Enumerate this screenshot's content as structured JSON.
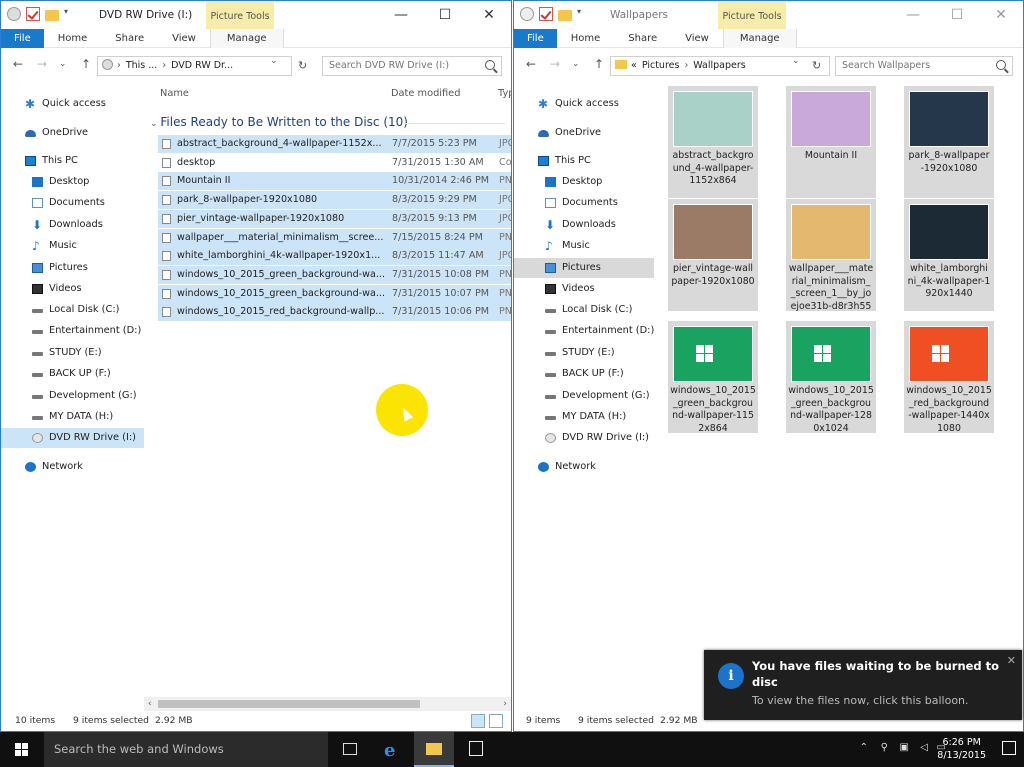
{
  "left_window": {
    "title": "DVD RW Drive (I:)",
    "context_tab": "Picture Tools",
    "ribbon_tabs": [
      "File",
      "Home",
      "Share",
      "View",
      "Manage"
    ],
    "address_crumbs": [
      "This ...",
      "DVD RW Dr..."
    ],
    "search_placeholder": "Search DVD RW Drive (I:)",
    "columns": {
      "name": "Name",
      "date": "Date modified",
      "type": "Typ"
    },
    "group_header": "Files Ready to Be Written to the Disc (10)",
    "files": [
      {
        "name": "abstract_background_4-wallpaper-1152x...",
        "date": "7/7/2015 5:23 PM",
        "type": "JPG",
        "selected": true
      },
      {
        "name": "desktop",
        "date": "7/31/2015 1:30 AM",
        "type": "Con",
        "selected": false
      },
      {
        "name": "Mountain II",
        "date": "10/31/2014 2:46 PM",
        "type": "PN",
        "selected": true
      },
      {
        "name": "park_8-wallpaper-1920x1080",
        "date": "8/3/2015 9:29 PM",
        "type": "JPG",
        "selected": true
      },
      {
        "name": "pier_vintage-wallpaper-1920x1080",
        "date": "8/3/2015 9:13 PM",
        "type": "JPG",
        "selected": true
      },
      {
        "name": "wallpaper___material_minimalism__scree...",
        "date": "7/15/2015 8:24 PM",
        "type": "PN",
        "selected": true
      },
      {
        "name": "white_lamborghini_4k-wallpaper-1920x1...",
        "date": "8/3/2015 11:47 AM",
        "type": "JPG",
        "selected": true
      },
      {
        "name": "windows_10_2015_green_background-wa...",
        "date": "7/31/2015 10:08 PM",
        "type": "PN",
        "selected": true
      },
      {
        "name": "windows_10_2015_green_background-wa...",
        "date": "7/31/2015 10:07 PM",
        "type": "PN",
        "selected": true
      },
      {
        "name": "windows_10_2015_red_background-wallp...",
        "date": "7/31/2015 10:06 PM",
        "type": "PN",
        "selected": true
      }
    ],
    "status_count": "10 items",
    "status_selected": "9 items selected",
    "status_size": "2.92 MB"
  },
  "right_window": {
    "title": "Wallpapers",
    "context_tab": "Picture Tools",
    "ribbon_tabs": [
      "File",
      "Home",
      "Share",
      "View",
      "Manage"
    ],
    "address_crumbs": [
      "«",
      "Pictures",
      "Wallpapers"
    ],
    "search_placeholder": "Search Wallpapers",
    "tiles": [
      {
        "label": "abstract_backgro und_4-wallpaper-1152x864",
        "color": "#a9d1c7"
      },
      {
        "label": "Mountain II",
        "color": "#c9a9d9"
      },
      {
        "label": "park_8-wallpaper -1920x1080",
        "color": "#25374a"
      },
      {
        "label": "pier_vintage-wall paper-1920x1080",
        "color": "#9b7b66"
      },
      {
        "label": "wallpaper___mate rial_minimalism_ _screen_1__by_jo ejoe31b-d8r3h55",
        "color": "#e5b86f"
      },
      {
        "label": "white_lamborghi ni_4k-wallpaper-1920x1440",
        "color": "#1c2a36"
      },
      {
        "label": "windows_10_2015 _green_backgrou nd-wallpaper-115 2x864",
        "color": "#1aa260"
      },
      {
        "label": "windows_10_2015 _green_backgrou nd-wallpaper-128 0x1024",
        "color": "#1aa260"
      },
      {
        "label": "windows_10_2015 _red_background -wallpaper-1440x 1080",
        "color": "#f04e23"
      }
    ],
    "status_count": "9 items",
    "status_selected": "9 items selected",
    "status_size": "2.92 MB"
  },
  "nav_items": [
    {
      "label": "Quick access",
      "icon": "star-icon"
    },
    {
      "label": "OneDrive",
      "icon": "cloud-icon"
    },
    {
      "label": "This PC",
      "icon": "computer-icon"
    },
    {
      "label": "Desktop",
      "icon": "desktop-icon"
    },
    {
      "label": "Documents",
      "icon": "documents-icon"
    },
    {
      "label": "Downloads",
      "icon": "download-icon"
    },
    {
      "label": "Music",
      "icon": "music-icon"
    },
    {
      "label": "Pictures",
      "icon": "pictures-icon"
    },
    {
      "label": "Videos",
      "icon": "videos-icon"
    },
    {
      "label": "Local Disk (C:)",
      "icon": "drive-icon"
    },
    {
      "label": "Entertainment (D:)",
      "icon": "drive-icon"
    },
    {
      "label": "STUDY (E:)",
      "icon": "drive-icon"
    },
    {
      "label": "BACK UP (F:)",
      "icon": "drive-icon"
    },
    {
      "label": "Development (G:)",
      "icon": "drive-icon"
    },
    {
      "label": "MY DATA (H:)",
      "icon": "drive-icon"
    },
    {
      "label": "DVD RW Drive (I:)",
      "icon": "dvd-icon"
    },
    {
      "label": "Network",
      "icon": "network-icon"
    }
  ],
  "notification": {
    "title": "You have files waiting to be burned to disc",
    "subtitle": "To view the files now, click this balloon.",
    "icon": "info-icon"
  },
  "taskbar": {
    "search_placeholder": "Search the web and Windows",
    "time": "6:26 PM",
    "date": "8/13/2015"
  }
}
